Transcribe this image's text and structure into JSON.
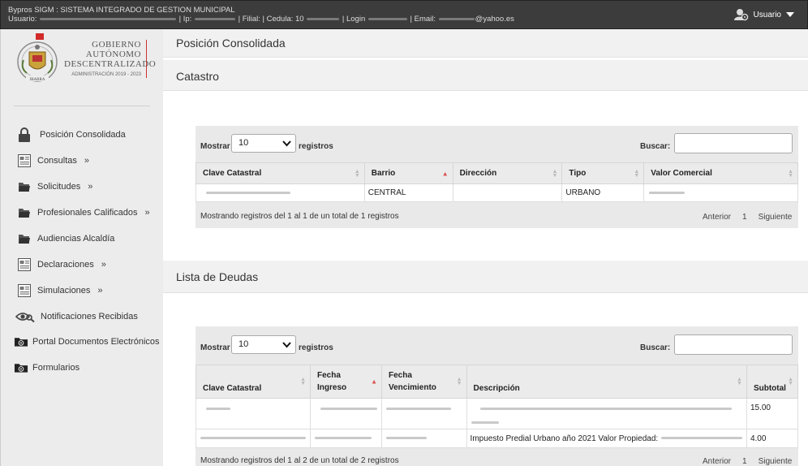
{
  "topbar": {
    "title": "Bypros SIGM : SISTEMA INTEGRADO DE GESTION MUNICIPAL",
    "usuario_label": "Usuario:",
    "ip_label": "| Ip:",
    "filial_label": "| Filial: | Cedula: 10",
    "login_label": "| Login",
    "email_label": "| Email:",
    "email_domain": "@yahoo.es",
    "user_menu_label": "Usuario"
  },
  "logo": {
    "line1": "GOBIERNO",
    "line2": "AUTÓNOMO",
    "line3": "DESCENTRALIZADO",
    "admin": "ADMINISTRACIÓN 2019 - 2023",
    "seal_text": "IBARRA"
  },
  "sidebar": {
    "items": [
      {
        "label": "Posición Consolidada",
        "icon": "lock-icon",
        "arrow": ""
      },
      {
        "label": "Consultas",
        "icon": "document-icon",
        "arrow": "»"
      },
      {
        "label": "Solicitudes",
        "icon": "folder-icon",
        "arrow": "»"
      },
      {
        "label": "Profesionales Calificados",
        "icon": "folder-icon",
        "arrow": "»"
      },
      {
        "label": "Audiencias Alcaldía",
        "icon": "folder-icon",
        "arrow": ""
      },
      {
        "label": "Declaraciones",
        "icon": "document-icon",
        "arrow": "»"
      },
      {
        "label": "Simulaciones",
        "icon": "document-icon",
        "arrow": "»"
      },
      {
        "label": "Notificaciones Recibidas",
        "icon": "eye-search-icon",
        "arrow": ""
      },
      {
        "label": "Portal Documentos Electrónicos",
        "icon": "email-folder-icon",
        "arrow": ""
      },
      {
        "label": "Formularios",
        "icon": "email-folder-icon",
        "arrow": ""
      }
    ]
  },
  "main": {
    "page_title": "Posición Consolidada",
    "catastro": {
      "title": "Catastro",
      "mostrar": "Mostrar",
      "registros": "registros",
      "page_size": "10",
      "buscar": "Buscar:",
      "columns": [
        "Clave Catastral",
        "Barrio",
        "Dirección",
        "Tipo",
        "Valor Comercial"
      ],
      "rows": [
        {
          "barrio": "CENTRAL",
          "direccion": "",
          "tipo": "URBANO"
        }
      ],
      "info": "Mostrando registros del 1 al 1 de un total de 1 registros",
      "prev": "Anterior",
      "page": "1",
      "next": "Siguiente"
    },
    "deudas": {
      "title": "Lista de Deudas",
      "mostrar": "Mostrar",
      "registros": "registros",
      "page_size": "10",
      "buscar": "Buscar:",
      "col_clave": "Clave Catastral",
      "col_fecha_ingreso_1": "Fecha",
      "col_fecha_ingreso_2": "Ingreso",
      "col_fecha_venc_1": "Fecha",
      "col_fecha_venc_2": "Vencimiento",
      "col_descripcion": "Descripción",
      "col_subtotal": "Subtotal",
      "rows": [
        {
          "descripcion": "",
          "subtotal": "15.00"
        },
        {
          "descripcion": "Impuesto Predial Urbano año 2021 Valor Propiedad:",
          "subtotal": "4.00"
        }
      ],
      "info": "Mostrando registros del 1 al 2 de un total de 2 registros",
      "prev": "Anterior",
      "page": "1",
      "next": "Siguiente"
    }
  },
  "colors": {
    "topbar": "#3c3c3c",
    "sidebar": "#ececec",
    "section_header": "#f1f1f1",
    "table_toolbar": "#e9e9e9",
    "sort_active": "#d9534f",
    "logo_accent": "#d32a2a"
  }
}
